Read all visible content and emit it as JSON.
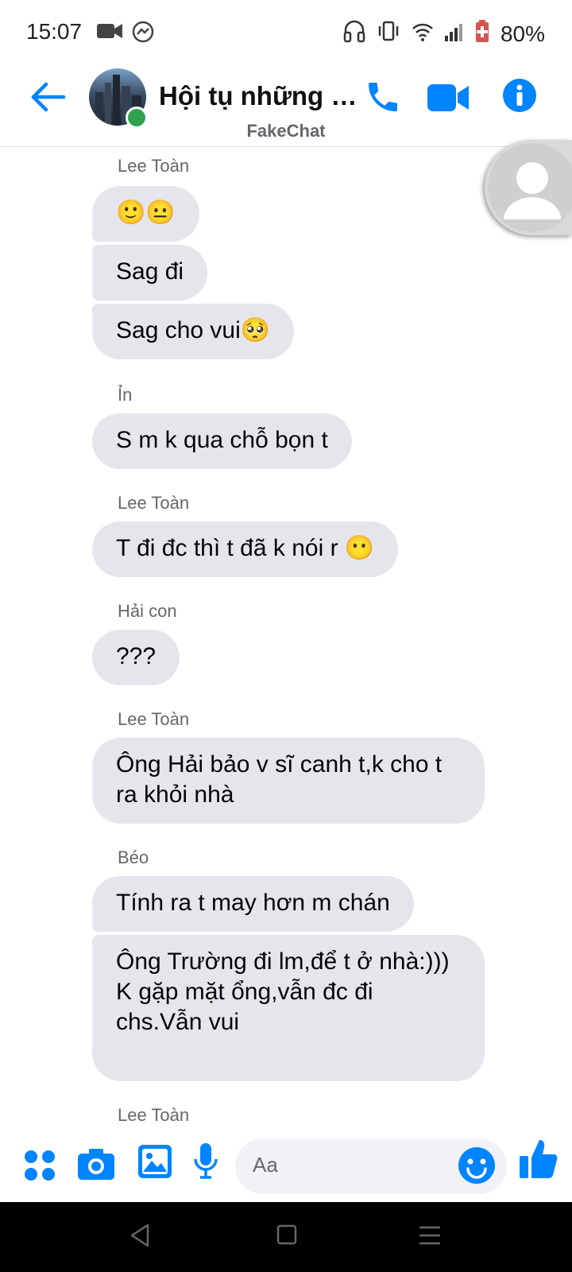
{
  "status_bar": {
    "time": "15:07",
    "battery": "80%",
    "icons": [
      "video-camera-icon",
      "messenger-icon",
      "headphones-icon",
      "vibrate-icon",
      "wifi-icon",
      "signal-icon",
      "battery-icon"
    ]
  },
  "header": {
    "title": "Hội tụ những n...",
    "subtitle": "FakeChat",
    "online_color": "#31a24c",
    "accent_color": "#0084ff"
  },
  "messages": [
    {
      "sender": "Lee Toàn",
      "bubbles": [
        "🙂😐",
        "Sag đi",
        "Sag cho vui🥺"
      ]
    },
    {
      "sender": "Ỉn",
      "bubbles": [
        "S m k qua chỗ bọn t"
      ]
    },
    {
      "sender": "Lee Toàn",
      "bubbles": [
        "T đi đc thì t đã k nói r 😶"
      ]
    },
    {
      "sender": "Hải con",
      "bubbles": [
        "???"
      ]
    },
    {
      "sender": "Lee Toàn",
      "bubbles": [
        "Ông Hải bảo v sĩ canh t,k cho t ra khỏi nhà"
      ]
    },
    {
      "sender": "Béo",
      "bubbles": [
        "Tính ra t may hơn m chán",
        "Ông Trường đi lm,để t ở nhà:)))\nK gặp mặt ổng,vẫn đc đi chs.Vẫn vui"
      ]
    },
    {
      "sender": "Lee Toàn",
      "bubbles": []
    }
  ],
  "composer": {
    "placeholder": "Aa"
  }
}
